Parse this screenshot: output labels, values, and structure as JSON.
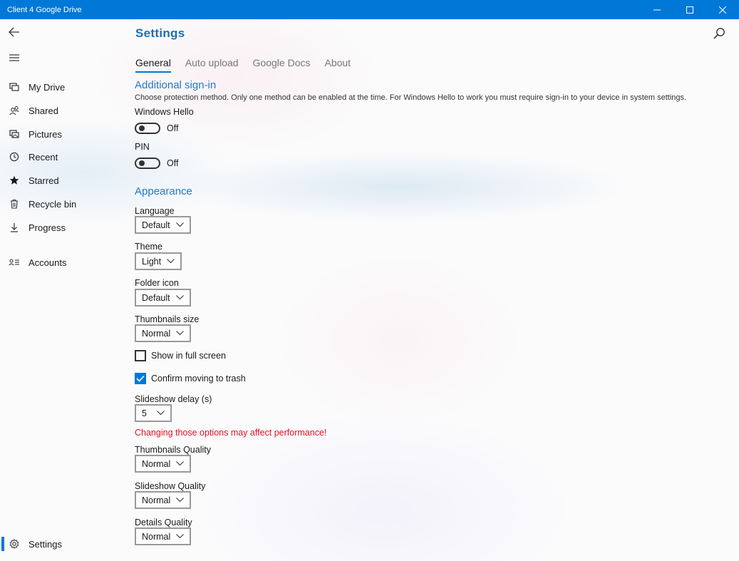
{
  "window": {
    "title": "Client 4 Google Drive",
    "accent": "#0078d7"
  },
  "sidebar": {
    "items": [
      {
        "label": "My Drive",
        "icon": "my-drive-icon"
      },
      {
        "label": "Shared",
        "icon": "shared-icon"
      },
      {
        "label": "Pictures",
        "icon": "pictures-icon"
      },
      {
        "label": "Recent",
        "icon": "clock-icon"
      },
      {
        "label": "Starred",
        "icon": "star-icon"
      },
      {
        "label": "Recycle bin",
        "icon": "trash-icon"
      },
      {
        "label": "Progress",
        "icon": "download-icon"
      },
      {
        "label": "Accounts",
        "icon": "accounts-icon"
      }
    ],
    "settings_label": "Settings"
  },
  "header": {
    "title": "Settings"
  },
  "tabs": [
    {
      "label": "General",
      "active": true
    },
    {
      "label": "Auto upload",
      "active": false
    },
    {
      "label": "Google Docs",
      "active": false
    },
    {
      "label": "About",
      "active": false
    }
  ],
  "signin": {
    "title": "Additional sign-in",
    "description": "Choose protection method. Only one method can be enabled at the time. For Windows Hello to work you must require sign-in to your device in system settings.",
    "windows_hello": {
      "label": "Windows Hello",
      "state": "Off"
    },
    "pin": {
      "label": "PIN",
      "state": "Off"
    }
  },
  "appearance": {
    "title": "Appearance",
    "language": {
      "label": "Language",
      "value": "Default"
    },
    "theme": {
      "label": "Theme",
      "value": "Light"
    },
    "folder_icon": {
      "label": "Folder icon",
      "value": "Default"
    },
    "thumbnails_size": {
      "label": "Thumbnails size",
      "value": "Normal"
    },
    "show_full_screen": {
      "label": "Show in full screen",
      "checked": false
    },
    "confirm_trash": {
      "label": "Confirm moving to trash",
      "checked": true
    },
    "slideshow_delay": {
      "label": "Slideshow delay (s)",
      "value": "5"
    },
    "warning": "Changing those options may affect performance!",
    "warning_color": "#e81123",
    "thumbnails_quality": {
      "label": "Thumbnails Quality",
      "value": "Normal"
    },
    "slideshow_quality": {
      "label": "Slideshow Quality",
      "value": "Normal"
    },
    "details_quality": {
      "label": "Details Quality",
      "value": "Normal"
    }
  }
}
